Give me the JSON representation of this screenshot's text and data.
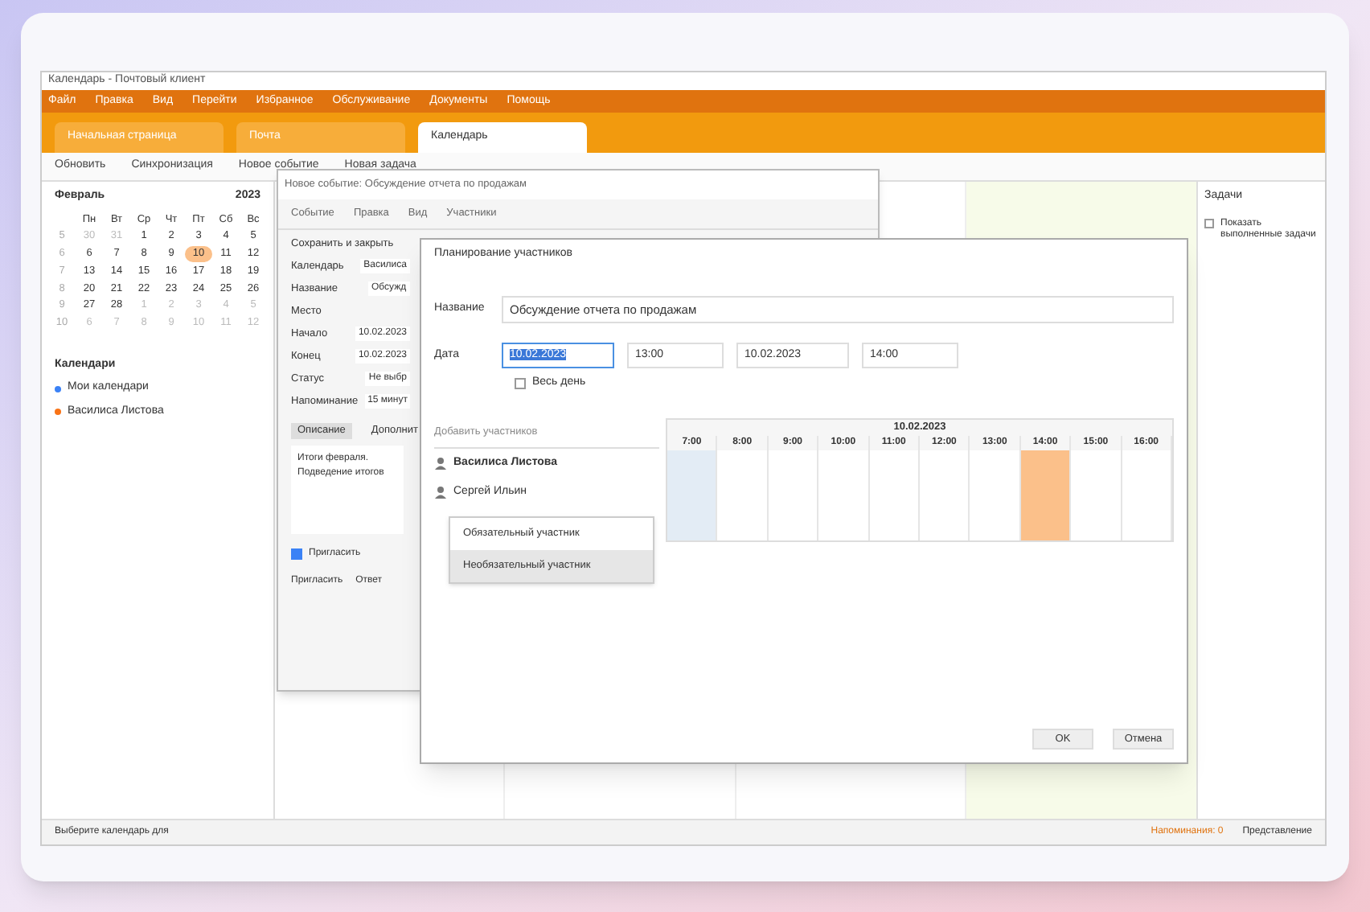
{
  "window": {
    "title": "Календарь - Почтовый клиент"
  },
  "menu": [
    "Файл",
    "Правка",
    "Вид",
    "Перейти",
    "Избранное",
    "Обслуживание",
    "Документы",
    "Помощь"
  ],
  "tabs": [
    {
      "label": "Начальная страница",
      "selected": false
    },
    {
      "label": "Почта",
      "selected": false
    },
    {
      "label": "Календарь",
      "selected": true
    }
  ],
  "toolbar": [
    "Обновить",
    "Синхронизация",
    "Новое событие",
    "Новая задача"
  ],
  "mini_calendar": {
    "month": "Февраль",
    "year": "2023",
    "weekdays": [
      "Пн",
      "Вт",
      "Ср",
      "Чт",
      "Пт",
      "Сб",
      "Вс"
    ],
    "weeks": [
      {
        "number": "5",
        "days": [
          {
            "day": "30",
            "other_month": true,
            "selected": false
          },
          {
            "day": "31",
            "other_month": true,
            "selected": false
          },
          {
            "day": "1",
            "other_month": false,
            "selected": false
          },
          {
            "day": "2",
            "other_month": false,
            "selected": false
          },
          {
            "day": "3",
            "other_month": false,
            "selected": false
          },
          {
            "day": "4",
            "other_month": false,
            "selected": false
          },
          {
            "day": "5",
            "other_month": false,
            "selected": false
          }
        ]
      },
      {
        "number": "6",
        "days": [
          {
            "day": "6",
            "other_month": false,
            "selected": false
          },
          {
            "day": "7",
            "other_month": false,
            "selected": false
          },
          {
            "day": "8",
            "other_month": false,
            "selected": false
          },
          {
            "day": "9",
            "other_month": false,
            "selected": false
          },
          {
            "day": "10",
            "other_month": false,
            "selected": true
          },
          {
            "day": "11",
            "other_month": false,
            "selected": false
          },
          {
            "day": "12",
            "other_month": false,
            "selected": false
          }
        ]
      },
      {
        "number": "7",
        "days": [
          {
            "day": "13",
            "other_month": false,
            "selected": false
          },
          {
            "day": "14",
            "other_month": false,
            "selected": false
          },
          {
            "day": "15",
            "other_month": false,
            "selected": false
          },
          {
            "day": "16",
            "other_month": false,
            "selected": false
          },
          {
            "day": "17",
            "other_month": false,
            "selected": false
          },
          {
            "day": "18",
            "other_month": false,
            "selected": false
          },
          {
            "day": "19",
            "other_month": false,
            "selected": false
          }
        ]
      },
      {
        "number": "8",
        "days": [
          {
            "day": "20",
            "other_month": false,
            "selected": false
          },
          {
            "day": "21",
            "other_month": false,
            "selected": false
          },
          {
            "day": "22",
            "other_month": false,
            "selected": false
          },
          {
            "day": "23",
            "other_month": false,
            "selected": false
          },
          {
            "day": "24",
            "other_month": false,
            "selected": false
          },
          {
            "day": "25",
            "other_month": false,
            "selected": false
          },
          {
            "day": "26",
            "other_month": false,
            "selected": false
          }
        ]
      },
      {
        "number": "9",
        "days": [
          {
            "day": "27",
            "other_month": false,
            "selected": false
          },
          {
            "day": "28",
            "other_month": false,
            "selected": false
          },
          {
            "day": "1",
            "other_month": true,
            "selected": false
          },
          {
            "day": "2",
            "other_month": true,
            "selected": false
          },
          {
            "day": "3",
            "other_month": true,
            "selected": false
          },
          {
            "day": "4",
            "other_month": true,
            "selected": false
          },
          {
            "day": "5",
            "other_month": true,
            "selected": false
          }
        ]
      },
      {
        "number": "10",
        "days": [
          {
            "day": "6",
            "other_month": true,
            "selected": false
          },
          {
            "day": "7",
            "other_month": true,
            "selected": false
          },
          {
            "day": "8",
            "other_month": true,
            "selected": false
          },
          {
            "day": "9",
            "other_month": true,
            "selected": false
          },
          {
            "day": "10",
            "other_month": true,
            "selected": false
          },
          {
            "day": "11",
            "other_month": true,
            "selected": false
          },
          {
            "day": "12",
            "other_month": true,
            "selected": false
          }
        ]
      }
    ]
  },
  "calendars": {
    "title": "Календари",
    "items": [
      {
        "label": "Мои календари",
        "color": "#3b82f6"
      },
      {
        "label": "Василиса Листова",
        "color": "#f97316"
      }
    ]
  },
  "event_dialog": {
    "title": "Новое событие: Обсуждение отчета по продажам",
    "menu": [
      "Событие",
      "Правка",
      "Вид",
      "Участники"
    ],
    "save": "Сохранить и закрыть",
    "fields": [
      {
        "label": "Календарь",
        "value": "Василиса"
      },
      {
        "label": "Название",
        "value": "Обсужд"
      },
      {
        "label": "Место"
      },
      {
        "label": "Начало",
        "value": "10.02.2023"
      },
      {
        "label": "Конец",
        "value": "10.02.2023"
      },
      {
        "label": "Статус",
        "value": "Не выбр"
      },
      {
        "label": "Напоминание",
        "value": "15 минут"
      }
    ],
    "tabs": [
      {
        "label": "Описание",
        "selected": true
      },
      {
        "label": "Дополнит",
        "selected": false
      }
    ],
    "description": "Итоги февраля. Подведение итогов",
    "invite": {
      "label": "Пригласить",
      "checked": true
    },
    "footer": [
      "Пригласить",
      "Ответ"
    ]
  },
  "planning_dialog": {
    "title": "Планирование участников",
    "name_label": "Название",
    "name_value": "Обсуждение отчета по продажам",
    "date_label": "Дата",
    "start_date": "10.02.2023",
    "start_time": "13:00",
    "end_date": "10.02.2023",
    "end_time": "14:00",
    "all_day": {
      "label": "Весь день",
      "checked": false
    },
    "add_placeholder": "Добавить участников",
    "participants": [
      {
        "name": "Василиса Листова",
        "organizer": true
      },
      {
        "name": "Сергей Ильин",
        "organizer": false
      }
    ],
    "schedule_date": "10.02.2023",
    "hours": [
      {
        "label": "7:00",
        "non_working": true,
        "busy": false
      },
      {
        "label": "8:00",
        "non_working": false,
        "busy": false
      },
      {
        "label": "9:00",
        "non_working": false,
        "busy": false
      },
      {
        "label": "10:00",
        "non_working": false,
        "busy": false
      },
      {
        "label": "11:00",
        "non_working": false,
        "busy": false
      },
      {
        "label": "12:00",
        "non_working": false,
        "busy": false
      },
      {
        "label": "13:00",
        "non_working": false,
        "busy": false
      },
      {
        "label": "14:00",
        "non_working": false,
        "busy": true
      },
      {
        "label": "15:00",
        "non_working": false,
        "busy": false
      },
      {
        "label": "16:00",
        "non_working": false,
        "busy": false
      }
    ],
    "role_menu": [
      {
        "label": "Обязательный участник",
        "selected": false
      },
      {
        "label": "Необязательный участник",
        "selected": true
      }
    ],
    "buttons": [
      "OK",
      "Отмена"
    ]
  },
  "tasks_panel": {
    "title": "Задачи",
    "show_completed": {
      "label": "Показать выполненные задачи",
      "checked": false
    }
  },
  "status_bar": {
    "hint": "Выберите календарь для",
    "reminders": "Напоминания: 0",
    "view": "Представление"
  }
}
